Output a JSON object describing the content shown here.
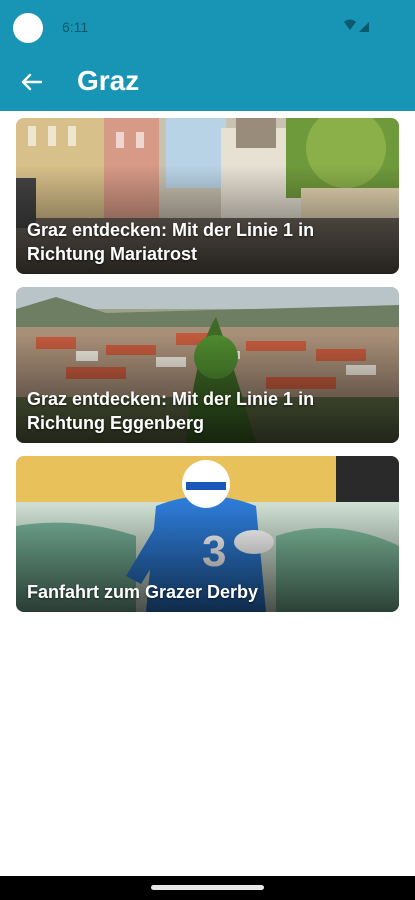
{
  "status": {
    "time": "6:11"
  },
  "header": {
    "title": "Graz"
  },
  "cards": [
    {
      "title": "Graz entdecken: Mit der Linie 1 in Richtung Mariatrost"
    },
    {
      "title": "Graz entdecken: Mit der Linie 1 in Richtung Eggenberg"
    },
    {
      "title": "Fanfahrt zum Grazer Derby"
    }
  ],
  "colors": {
    "accent": "#1895b4",
    "background": "#ffffff"
  },
  "icons": [
    "back-arrow-icon",
    "wifi-icon",
    "signal-icon"
  ]
}
